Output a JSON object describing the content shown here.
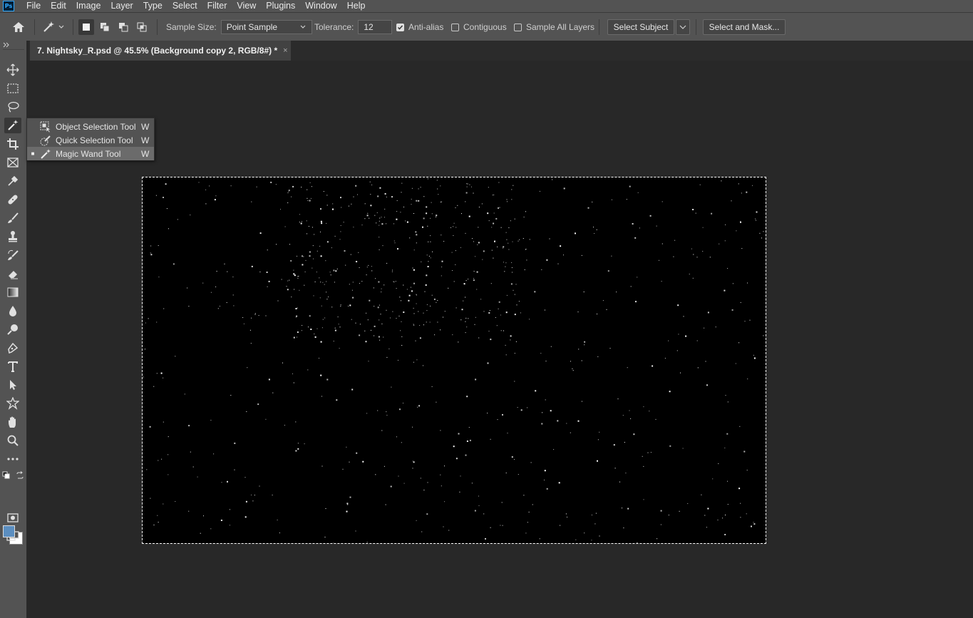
{
  "app": {
    "logo_text": "Ps"
  },
  "menu": [
    "File",
    "Edit",
    "Image",
    "Layer",
    "Type",
    "Select",
    "Filter",
    "View",
    "Plugins",
    "Window",
    "Help"
  ],
  "options": {
    "sample_size_label": "Sample Size:",
    "sample_size_value": "Point Sample",
    "tolerance_label": "Tolerance:",
    "tolerance_value": "12",
    "anti_alias_label": "Anti-alias",
    "anti_alias_checked": true,
    "contiguous_label": "Contiguous",
    "contiguous_checked": false,
    "sample_all_layers_label": "Sample All Layers",
    "sample_all_layers_checked": false,
    "select_subject_label": "Select Subject",
    "select_and_mask_label": "Select and Mask..."
  },
  "document": {
    "tab_title": "7. Nightsky_R.psd @ 45.5% (Background copy 2, RGB/8#) *",
    "close_glyph": "×"
  },
  "flyout": {
    "items": [
      {
        "label": "Object Selection Tool",
        "shortcut": "W",
        "selected": false,
        "icon": "object-selection-icon"
      },
      {
        "label": "Quick Selection Tool",
        "shortcut": "W",
        "selected": false,
        "icon": "quick-selection-icon"
      },
      {
        "label": "Magic Wand Tool",
        "shortcut": "W",
        "selected": true,
        "icon": "magic-wand-icon"
      }
    ]
  },
  "colors": {
    "foreground": "#5b8ec0",
    "background": "#ffffff",
    "ui_panel": "#535353",
    "canvas_bg": "#282828"
  }
}
